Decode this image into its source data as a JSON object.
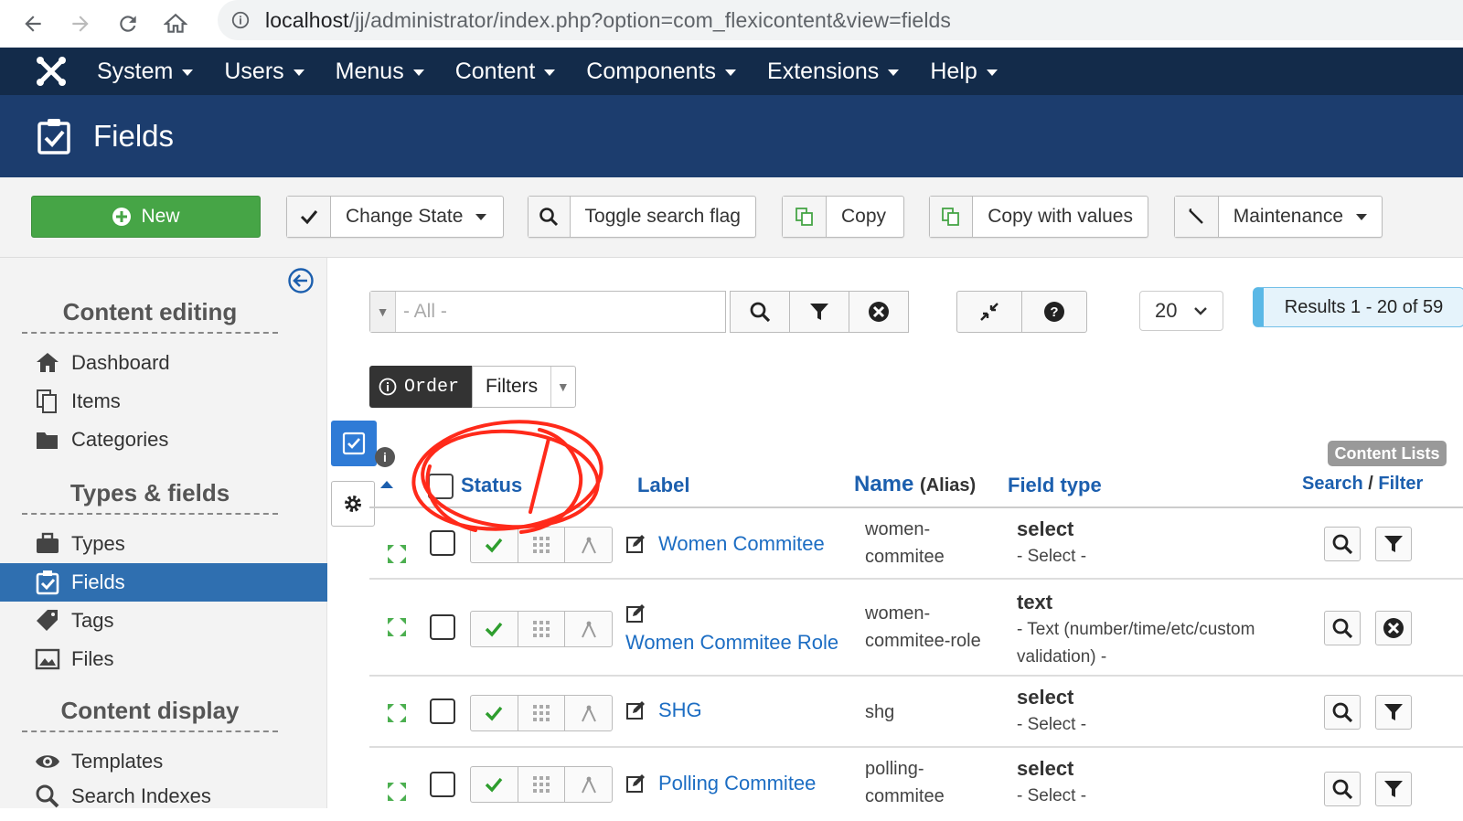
{
  "browser": {
    "url_host": "localhost",
    "url_path": "/jj/administrator/index.php?option=com_flexicontent&view=fields"
  },
  "topnav": {
    "items": [
      "System",
      "Users",
      "Menus",
      "Content",
      "Components",
      "Extensions",
      "Help"
    ]
  },
  "header": {
    "title": "Fields"
  },
  "toolbar": {
    "new_label": "New",
    "change_state_label": "Change State",
    "toggle_search_label": "Toggle search flag",
    "copy_label": "Copy",
    "copy_values_label": "Copy with values",
    "maintenance_label": "Maintenance"
  },
  "sidebar": {
    "section1": "Content editing",
    "section2": "Types & fields",
    "section3": "Content display",
    "items": [
      "Dashboard",
      "Items",
      "Categories",
      "Types",
      "Fields",
      "Tags",
      "Files",
      "Templates",
      "Search Indexes"
    ]
  },
  "filters": {
    "search_placeholder": "- All -",
    "limit": "20",
    "results": "Results 1 - 20 of 59",
    "order_label": "Order",
    "filters_label": "Filters"
  },
  "table": {
    "content_lists_badge": "Content Lists",
    "col_status": "Status",
    "col_label": "Label",
    "col_name": "Name",
    "col_alias": "(Alias)",
    "col_field_type": "Field type",
    "col_search": "Search",
    "col_sep": " / ",
    "col_filter": "Filter",
    "rows": [
      {
        "label": "Women Commitee",
        "alias1": "women-",
        "alias2": "commitee",
        "type": "select",
        "desc1": "- Select -",
        "desc2": ""
      },
      {
        "label": "Women Commitee Role",
        "alias1": "women-",
        "alias2": "commitee-role",
        "type": "text",
        "desc1": "- Text (number/time/etc/custom",
        "desc2": "validation) -"
      },
      {
        "label": "SHG",
        "alias1": "shg",
        "alias2": "",
        "type": "select",
        "desc1": "- Select -",
        "desc2": ""
      },
      {
        "label": "Polling Commitee",
        "alias1": "polling-",
        "alias2": "commitee",
        "type": "select",
        "desc1": "- Select -",
        "desc2": ""
      }
    ]
  },
  "colors": {
    "nav": "#132b4a",
    "header": "#1c3d6e",
    "new_button": "#46a546",
    "link": "#1c6dc3",
    "active": "#2f6fb0",
    "annotation": "#ff2a1a"
  },
  "icons": [
    "joomla-logo-icon",
    "fields-check-icon",
    "plus-circle-icon",
    "check-icon",
    "search-icon",
    "copy-icon",
    "wrench-icon",
    "collapse-arrow-icon",
    "home-icon",
    "items-icon",
    "folder-icon",
    "types-icon",
    "tag-icon",
    "image-icon",
    "eye-icon",
    "filter-icon",
    "clear-icon",
    "compress-icon",
    "help-icon",
    "gear-icon",
    "drag-icon",
    "edit-icon",
    "grid-icon",
    "hierarchy-icon"
  ]
}
